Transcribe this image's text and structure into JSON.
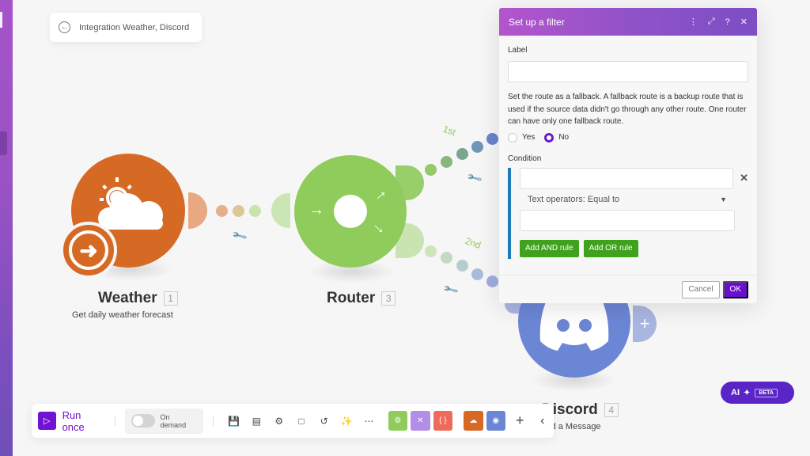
{
  "breadcrumb": {
    "back_icon": "arrow-left-circle",
    "title": "Integration Weather, Discord"
  },
  "nodes": {
    "weather": {
      "title": "Weather",
      "number": "1",
      "subtitle": "Get daily weather forecast",
      "color": "#d66a24"
    },
    "router": {
      "title": "Router",
      "number": "3",
      "color": "#8fcc5c"
    },
    "discord": {
      "title": "Discord",
      "number": "4",
      "subtitle": "Send a Message",
      "color": "#6c86d6"
    }
  },
  "routes": {
    "first": "1st",
    "second": "2nd"
  },
  "filter_dialog": {
    "title": "Set up a filter",
    "header_icons": [
      "more-vertical",
      "expand",
      "help",
      "close"
    ],
    "label_title": "Label",
    "label_value": "",
    "fallback_help": "Set the route as a fallback. A fallback route is a backup route that is used if the source data didn't go through any other route. One router can have only one fallback route.",
    "fallback_options": [
      {
        "label": "Yes",
        "selected": false
      },
      {
        "label": "No",
        "selected": true
      }
    ],
    "condition_title": "Condition",
    "condition_left_value": "",
    "operator": "Text operators: Equal to",
    "condition_right_value": "",
    "add_and_label": "Add AND rule",
    "add_or_label": "Add OR rule",
    "cancel_label": "Cancel",
    "ok_label": "OK"
  },
  "ai_button": {
    "label": "AI",
    "badge": "BETA"
  },
  "toolbar": {
    "run_once_label": "Run once",
    "schedule_label": "On demand",
    "schedule_enabled": false,
    "tools": [
      "save",
      "explain-flow",
      "settings",
      "notes",
      "undo",
      "auto-align",
      "more"
    ],
    "modules": [
      {
        "name": "tools",
        "color": "#8fcc5c"
      },
      {
        "name": "flow-control",
        "color": "#b38ee6"
      },
      {
        "name": "json",
        "color": "#ee6a5a"
      },
      {
        "name": "weather",
        "color": "#d66a24"
      },
      {
        "name": "discord",
        "color": "#6c86d6"
      }
    ]
  },
  "colors": {
    "accent": "#7212d4",
    "header_start": "#b455cc",
    "header_end": "#7d4ec4",
    "green_button": "#3fa21d",
    "condition_bar": "#1f7ab8"
  }
}
